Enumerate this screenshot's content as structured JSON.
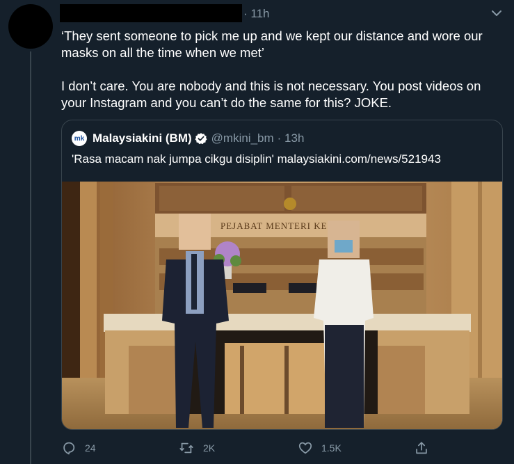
{
  "tweet": {
    "timestamp": "· 11h",
    "paragraphs": [
      "‘They sent someone to pick me up and we kept our distance and wore our masks on all the time when we met’",
      "I don’t care. You are nobody and this is not necessary. You post videos on your Instagram and you can’t do the same for this? JOKE."
    ]
  },
  "quoted": {
    "logo_text": "mk",
    "name": "Malaysiakini (BM)",
    "handle": "@mkini_bm",
    "timestamp": "· 13h",
    "text": "'Rasa macam nak jumpa cikgu disiplin' malaysiakini.com/news/521943",
    "image": {
      "sign_text": "PEJABAT MENTERI KES"
    }
  },
  "actions": {
    "reply_count": "24",
    "retweet_count": "2K",
    "like_count": "1.5K"
  },
  "colors": {
    "background": "#15202b",
    "border": "#38444d",
    "secondary_text": "#8899a6",
    "verified": "#ffffff"
  },
  "icons": [
    "chevron-down-icon",
    "verified-badge-icon",
    "reply-icon",
    "retweet-icon",
    "like-icon",
    "share-icon"
  ]
}
